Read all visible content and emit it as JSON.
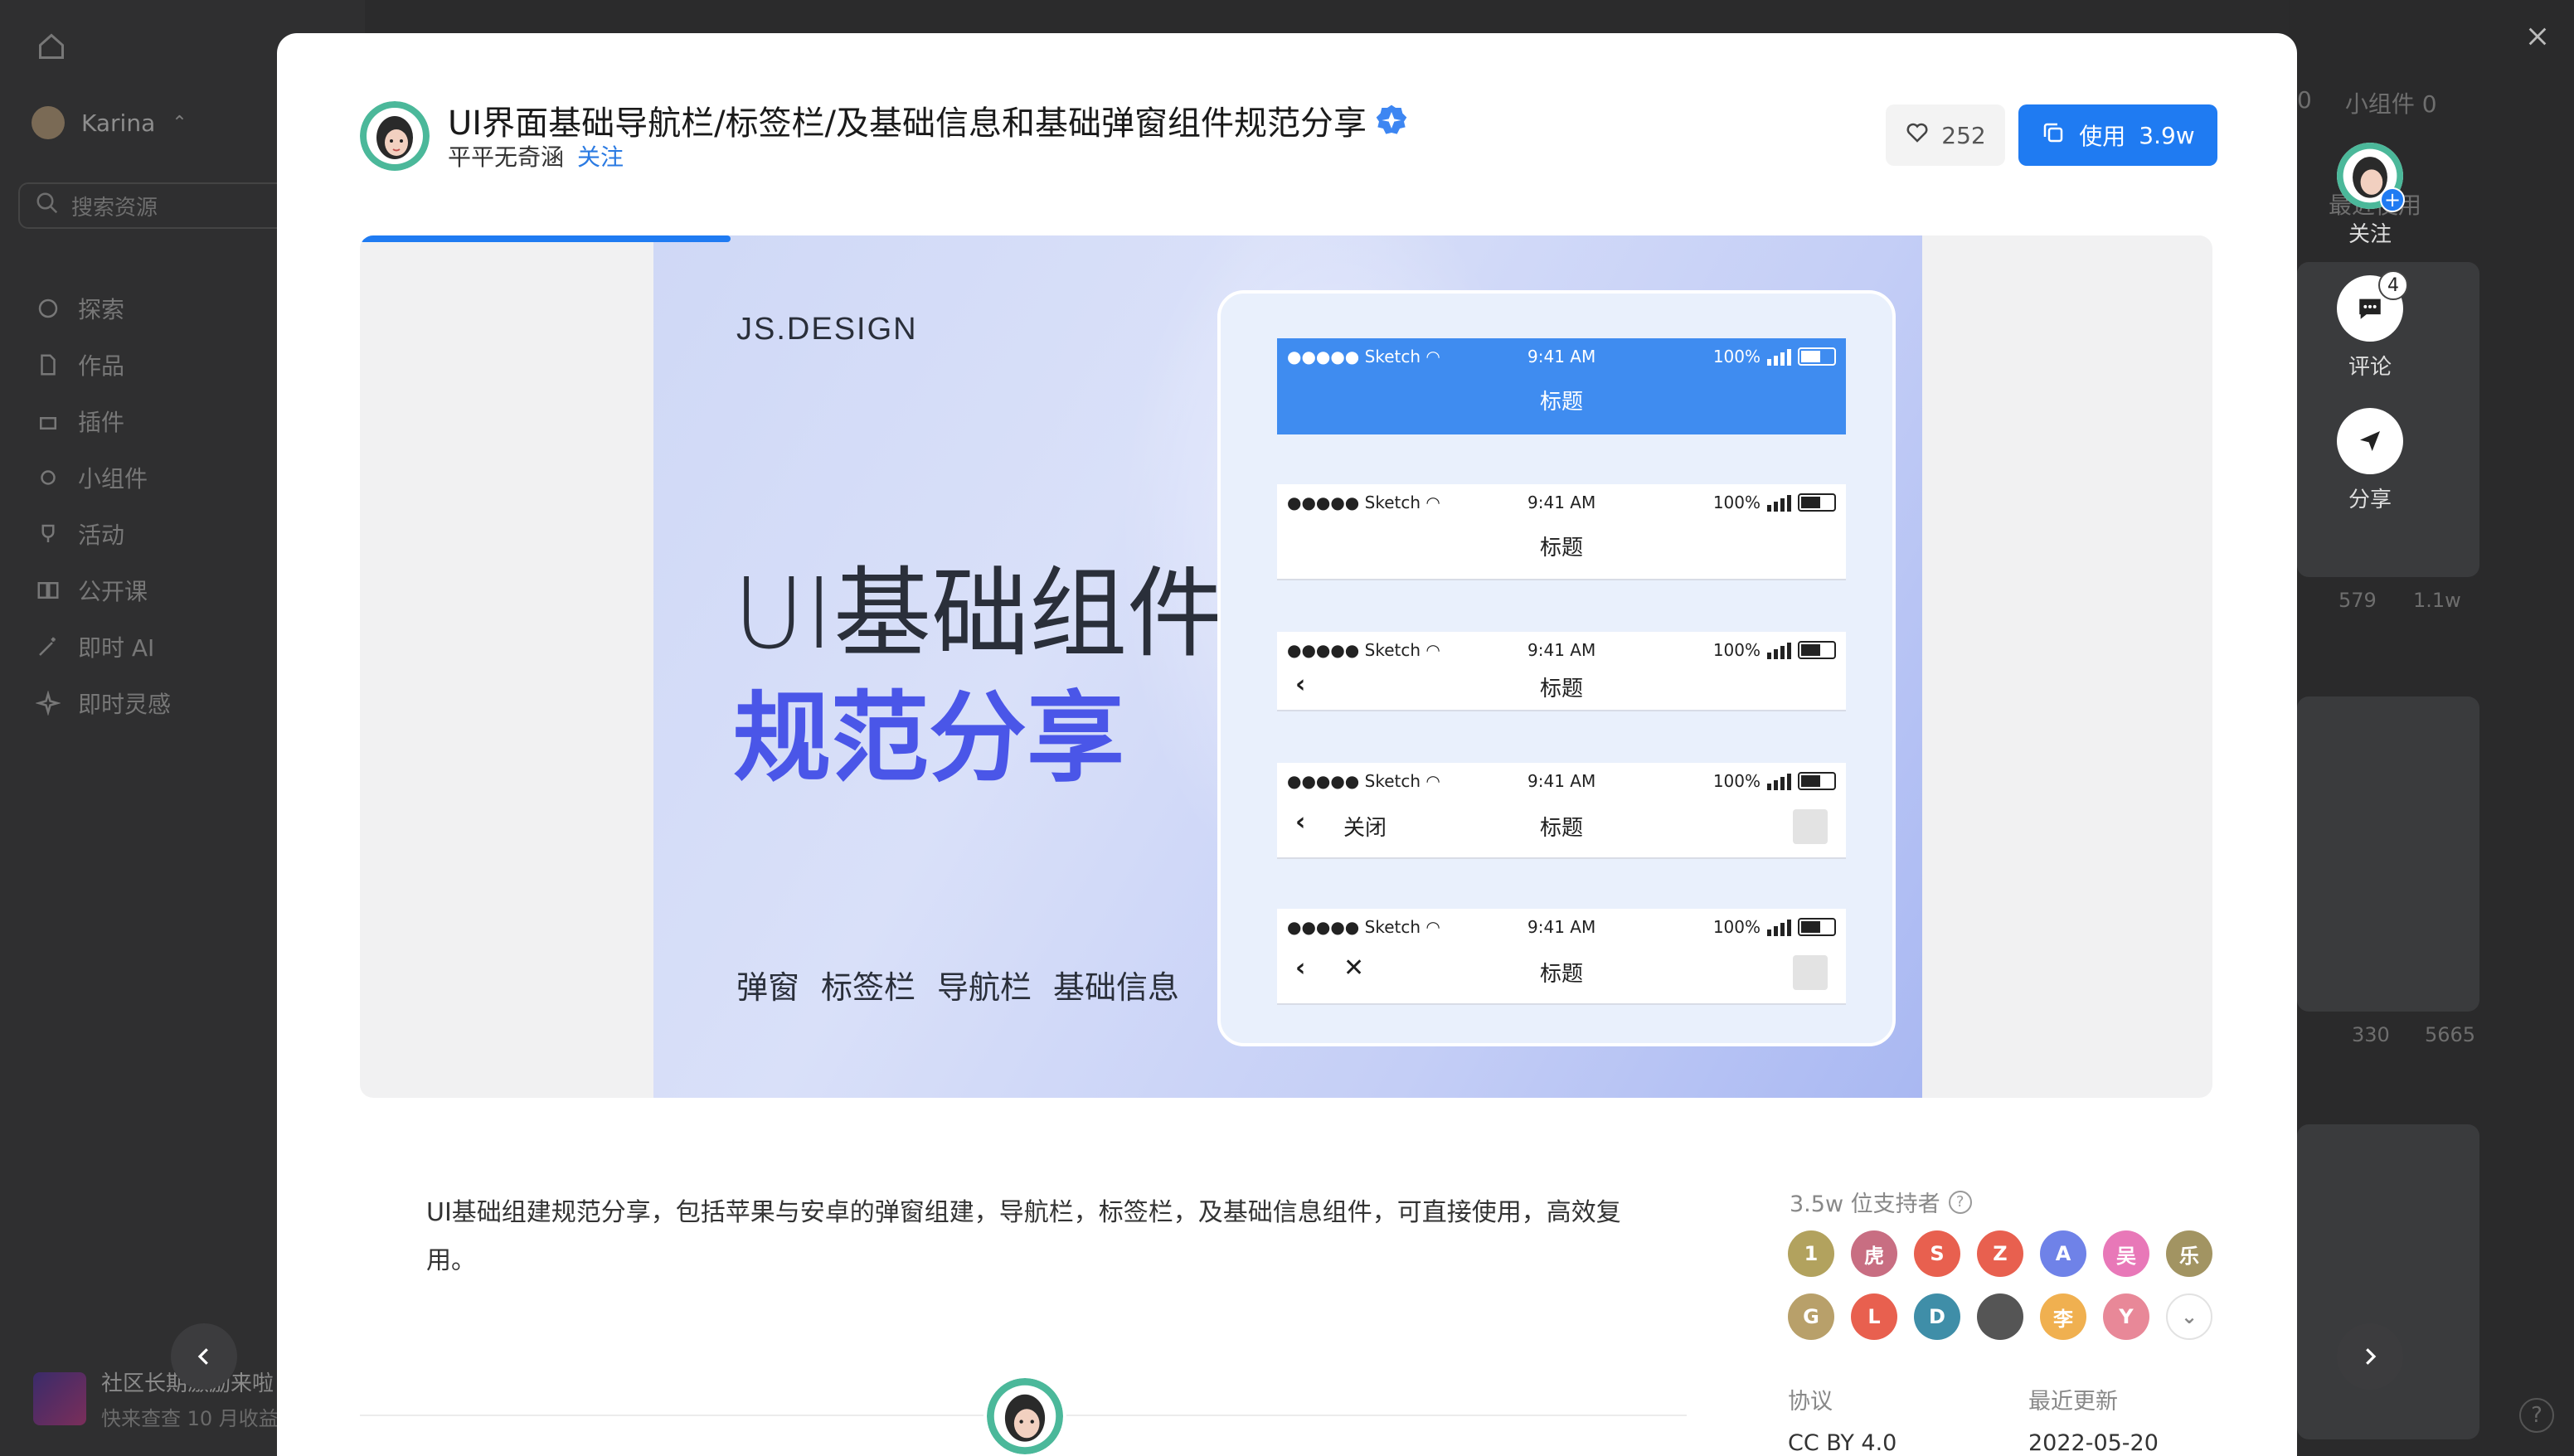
{
  "background": {
    "user_name": "Karina",
    "search_placeholder": "搜索资源",
    "nav": [
      "探索",
      "作品",
      "插件",
      "小组件",
      "活动",
      "公开课",
      "即时 AI",
      "即时灵感"
    ],
    "tabs": [
      "0",
      "小组件 0"
    ],
    "sort_label": "最近使用",
    "card_stats": [
      "579",
      "1.1w",
      "330",
      "5665"
    ],
    "promo_title": "社区长期激励来啦",
    "promo_sub": "快来查查 10 月收益",
    "help": "?"
  },
  "modal": {
    "title": "UI界面基础导航栏/标签栏/及基础信息和基础弹窗组件规范分享",
    "author": "平平无奇涵",
    "follow": "关注",
    "likes": "252",
    "use_label": "使用",
    "use_count": "3.9w",
    "progress": 0.2,
    "cover": {
      "brand": "JS.DESIGN",
      "heading_line1": "UI基础组件",
      "heading_line2": "规范分享",
      "tags": [
        "弹窗",
        "标签栏",
        "导航栏",
        "基础信息"
      ],
      "status": {
        "carrier": "Sketch",
        "time": "9:41 AM",
        "battery": "100%"
      },
      "bar_title": "标题",
      "close_text": "关闭",
      "accent": "#3f8cf0"
    },
    "description": "UI基础组建规范分享，包括苹果与安卓的弹窗组建，导航栏，标签栏，及基础信息组件，可直接使用，高效复用。",
    "supporters_title": "3.5w 位支持者",
    "supporters": [
      {
        "t": "1",
        "c": "#b2a25e"
      },
      {
        "t": "虎",
        "c": "#c86e82"
      },
      {
        "t": "S",
        "c": "#e8604f"
      },
      {
        "t": "Z",
        "c": "#e8604f"
      },
      {
        "t": "A",
        "c": "#6f82e8"
      },
      {
        "t": "吴",
        "c": "#e878b8"
      },
      {
        "t": "乐",
        "c": "#a29462"
      },
      {
        "t": "G",
        "c": "#b8a06a"
      },
      {
        "t": "L",
        "c": "#e8604f"
      },
      {
        "t": "D",
        "c": "#3f8ea8"
      },
      {
        "t": "",
        "c": "#555555"
      },
      {
        "t": "李",
        "c": "#f0b050"
      },
      {
        "t": "Y",
        "c": "#e88898"
      }
    ],
    "license_label": "协议",
    "license_value": "CC BY 4.0",
    "updated_label": "最近更新",
    "updated_value": "2022-05-20"
  },
  "actions": {
    "follow": "关注",
    "comment": "评论",
    "comment_count": "4",
    "share": "分享"
  }
}
